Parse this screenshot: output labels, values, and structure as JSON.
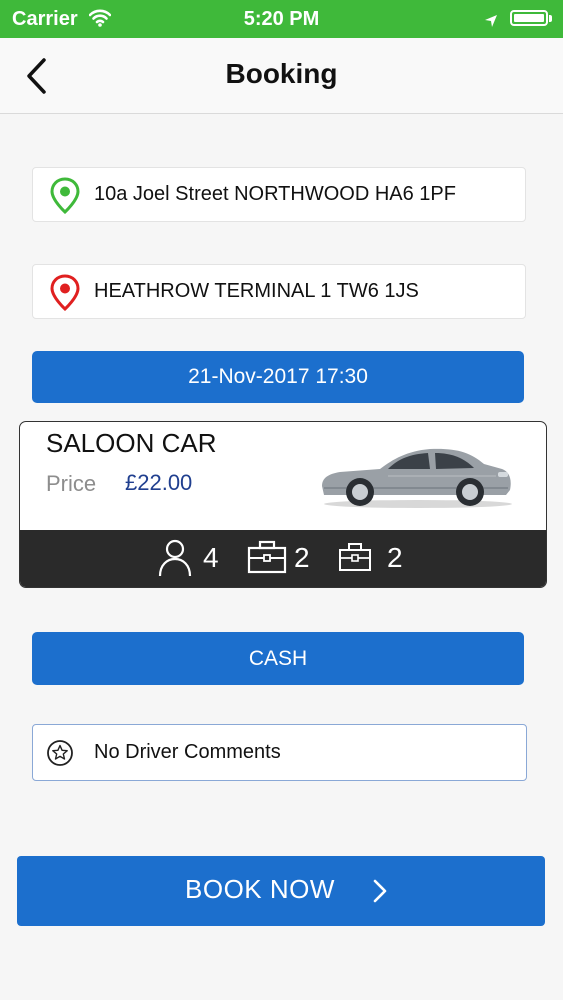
{
  "status_bar": {
    "carrier": "Carrier",
    "time": "5:20 PM",
    "icons": [
      "wifi-icon",
      "location-arrow-icon",
      "battery-icon"
    ]
  },
  "nav": {
    "title": "Booking",
    "back_icon": "chevron-left-icon"
  },
  "pickup": {
    "icon": "map-pin-icon",
    "icon_color": "#3fb93a",
    "address": "10a Joel Street NORTHWOOD HA6 1PF"
  },
  "dropoff": {
    "icon": "map-pin-icon",
    "icon_color": "#e02020",
    "address": "HEATHROW TERMINAL 1 TW6 1JS"
  },
  "datetime_button": "21-Nov-2017 17:30",
  "vehicle": {
    "name": "SALOON CAR",
    "price_label": "Price",
    "price": "£22.00",
    "price_color": "#203f8f",
    "image": "saloon-car-image",
    "capacity": {
      "passengers": "4",
      "large_luggage": "2",
      "small_luggage": "2"
    }
  },
  "payment_button": "CASH",
  "comments": {
    "icon": "star-icon",
    "text": "No Driver Comments"
  },
  "book_button": {
    "label": "BOOK NOW",
    "icon": "chevron-right-icon"
  },
  "colors": {
    "status_bar": "#3fb93a",
    "accent_blue": "#1c6fcd",
    "background": "#f6f6f6"
  }
}
